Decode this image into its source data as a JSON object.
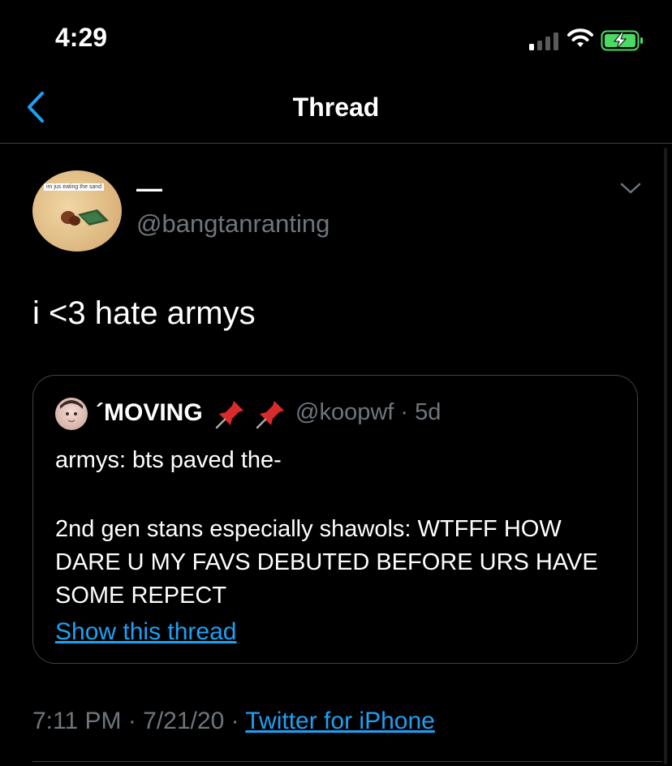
{
  "status_bar": {
    "time": "4:29"
  },
  "nav": {
    "title": "Thread"
  },
  "tweet": {
    "avatar_caption": "im jus eating the sand",
    "display_name": "—",
    "handle": "@bangtanranting",
    "text": "i <3 hate armys"
  },
  "quote": {
    "name": "´MOVING",
    "meta": "@koopwf · 5d",
    "line1": "armys: bts paved the-",
    "paragraph": "2nd gen stans especially shawols: WTFFF HOW DARE U MY FAVS DEBUTED BEFORE URS HAVE SOME REPECT",
    "link": "Show this thread"
  },
  "footer": {
    "timestamp": "7:11 PM · 7/21/20 · ",
    "source": "Twitter for iPhone"
  },
  "colors": {
    "accent": "#1da1f2",
    "muted": "#6e767d",
    "divider": "#3d4148",
    "battery": "#4cd964"
  }
}
